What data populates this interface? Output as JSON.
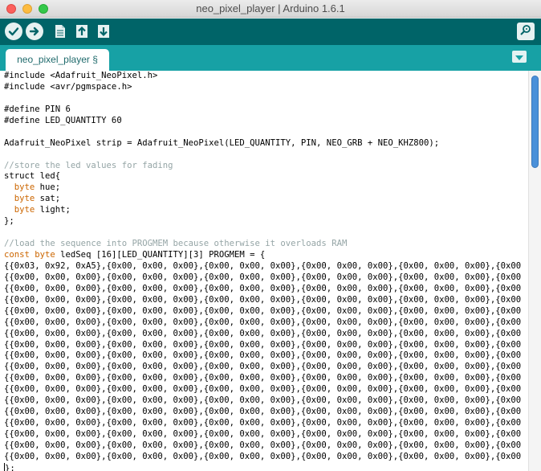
{
  "window": {
    "title": "neo_pixel_player | Arduino 1.6.1"
  },
  "toolbar": {
    "buttons": [
      {
        "name": "verify",
        "icon": "check-icon"
      },
      {
        "name": "upload",
        "icon": "arrow-right-icon"
      },
      {
        "name": "new",
        "icon": "new-document-icon"
      },
      {
        "name": "open",
        "icon": "arrow-up-icon"
      },
      {
        "name": "save",
        "icon": "arrow-down-icon"
      }
    ],
    "serial_monitor_icon": "magnifier-icon"
  },
  "tabs": [
    {
      "label": "neo_pixel_player §",
      "active": true
    }
  ],
  "tab_menu_icon": "chevron-down-icon",
  "colors": {
    "toolbar": "#006468",
    "tabstrip": "#17a1a5",
    "keyword": "#cc6600",
    "comment": "#95a5a6"
  },
  "editor": {
    "lines": [
      "#include <Adafruit_NeoPixel.h>",
      "#include <avr/pgmspace.h>",
      "",
      "#define PIN 6",
      "#define LED_QUANTITY 60",
      "",
      "Adafruit_NeoPixel strip = Adafruit_NeoPixel(LED_QUANTITY, PIN, NEO_GRB + NEO_KHZ800);",
      "",
      "//store the led values for fading",
      "struct led{",
      "  byte hue;",
      "  byte sat;",
      "  byte light;",
      "};",
      "",
      "//load the sequence into PROGMEM because otherwise it overloads RAM",
      "const byte ledSeq [16][LED_QUANTITY][3] PROGMEM = {",
      "{{0x03, 0x92, 0xA5},{0x00, 0x00, 0x00},{0x00, 0x00, 0x00},{0x00, 0x00, 0x00},{0x00, 0x00, 0x00},{0x00, 0x00,",
      "{{0x00, 0x00, 0x00},{0x00, 0x00, 0x00},{0x00, 0x00, 0x00},{0x00, 0x00, 0x00},{0x00, 0x00, 0x00},{0x00, 0x00,",
      "{{0x00, 0x00, 0x00},{0x00, 0x00, 0x00},{0x00, 0x00, 0x00},{0x00, 0x00, 0x00},{0x00, 0x00, 0x00},{0x00, 0x00,",
      "{{0x00, 0x00, 0x00},{0x00, 0x00, 0x00},{0x00, 0x00, 0x00},{0x00, 0x00, 0x00},{0x00, 0x00, 0x00},{0x00, 0x00,",
      "{{0x00, 0x00, 0x00},{0x00, 0x00, 0x00},{0x00, 0x00, 0x00},{0x00, 0x00, 0x00},{0x00, 0x00, 0x00},{0x00, 0x00,",
      "{{0x00, 0x00, 0x00},{0x00, 0x00, 0x00},{0x00, 0x00, 0x00},{0x00, 0x00, 0x00},{0x00, 0x00, 0x00},{0x00, 0x00,",
      "{{0x00, 0x00, 0x00},{0x00, 0x00, 0x00},{0x00, 0x00, 0x00},{0x00, 0x00, 0x00},{0x00, 0x00, 0x00},{0x00, 0x00,",
      "{{0x00, 0x00, 0x00},{0x00, 0x00, 0x00},{0x00, 0x00, 0x00},{0x00, 0x00, 0x00},{0x00, 0x00, 0x00},{0x00, 0x00,",
      "{{0x00, 0x00, 0x00},{0x00, 0x00, 0x00},{0x00, 0x00, 0x00},{0x00, 0x00, 0x00},{0x00, 0x00, 0x00},{0x00, 0x00,",
      "{{0x00, 0x00, 0x00},{0x00, 0x00, 0x00},{0x00, 0x00, 0x00},{0x00, 0x00, 0x00},{0x00, 0x00, 0x00},{0x00, 0x00,",
      "{{0x00, 0x00, 0x00},{0x00, 0x00, 0x00},{0x00, 0x00, 0x00},{0x00, 0x00, 0x00},{0x00, 0x00, 0x00},{0x00, 0x00,",
      "{{0x00, 0x00, 0x00},{0x00, 0x00, 0x00},{0x00, 0x00, 0x00},{0x00, 0x00, 0x00},{0x00, 0x00, 0x00},{0x00, 0x00,",
      "{{0x00, 0x00, 0x00},{0x00, 0x00, 0x00},{0x00, 0x00, 0x00},{0x00, 0x00, 0x00},{0x00, 0x00, 0x00},{0x00, 0x00,",
      "{{0x00, 0x00, 0x00},{0x00, 0x00, 0x00},{0x00, 0x00, 0x00},{0x00, 0x00, 0x00},{0x00, 0x00, 0x00},{0x00, 0x00,",
      "{{0x00, 0x00, 0x00},{0x00, 0x00, 0x00},{0x00, 0x00, 0x00},{0x00, 0x00, 0x00},{0x00, 0x00, 0x00},{0x00, 0x00,",
      "{{0x00, 0x00, 0x00},{0x00, 0x00, 0x00},{0x00, 0x00, 0x00},{0x00, 0x00, 0x00},{0x00, 0x00, 0x00},{0x00, 0x00,",
      "{{0x00, 0x00, 0x00},{0x00, 0x00, 0x00},{0x00, 0x00, 0x00},{0x00, 0x00, 0x00},{0x00, 0x00, 0x00},{0x00, 0x00,",
      "{{0x00, 0x00, 0x00},{0x00, 0x00, 0x00},{0x00, 0x00, 0x00},{0x00, 0x00, 0x00},{0x00, 0x00, 0x00},{0x00, 0x00,",
      "};"
    ],
    "keywords": [
      "byte",
      "const"
    ]
  }
}
